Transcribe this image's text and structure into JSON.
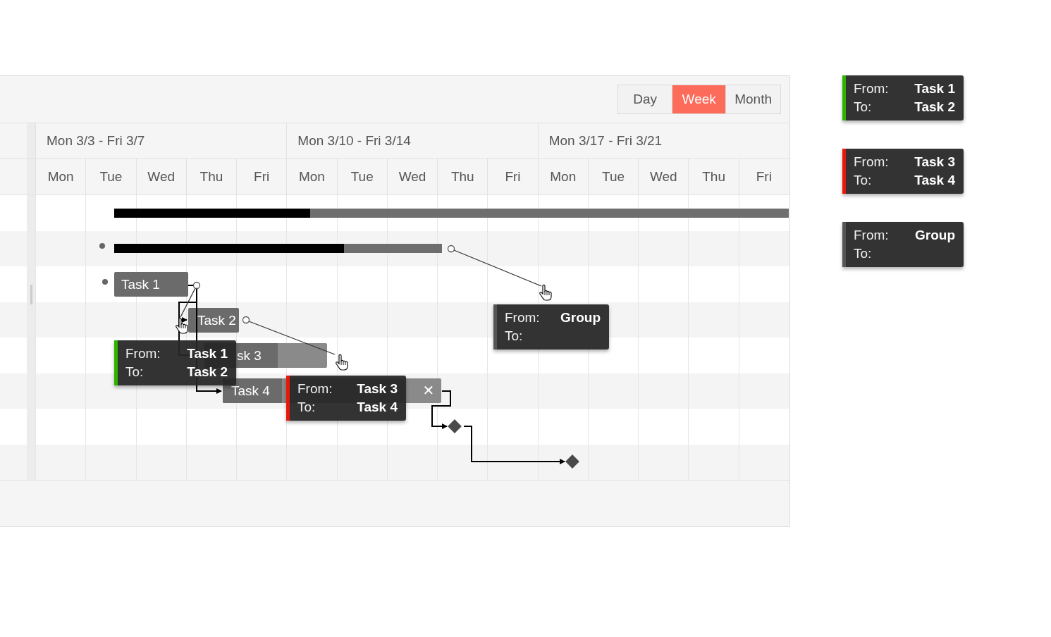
{
  "view_switcher": [
    {
      "label": "Day",
      "selected": false
    },
    {
      "label": "Week",
      "selected": true
    },
    {
      "label": "Month",
      "selected": false
    }
  ],
  "weeks": [
    "Mon 3/3 - Fri 3/7",
    "Mon 3/10 - Fri 3/14",
    "Mon 3/17 - Fri 3/21"
  ],
  "days": [
    "Mon",
    "Tue",
    "Wed",
    "Thu",
    "Fri",
    "Mon",
    "Tue",
    "Wed",
    "Thu",
    "Fri",
    "Mon",
    "Tue",
    "Wed",
    "Thu",
    "Fri"
  ],
  "bars": [
    {
      "kind": "summary",
      "level": 0.29
    },
    {
      "kind": "summary",
      "level": 0.7
    },
    {
      "kind": "task",
      "label": "Task 1"
    },
    {
      "kind": "task",
      "label": "Task 2"
    },
    {
      "kind": "task",
      "label": "sk 3",
      "level": 0.6
    },
    {
      "kind": "task",
      "label": "Task 4",
      "level": 0.27,
      "delete": "✕"
    },
    {
      "kind": "milestone"
    },
    {
      "kind": "milestone"
    }
  ],
  "chart_tooltips": [
    {
      "from_label": "From:",
      "from": "Task 1",
      "to_label": "To:",
      "to": "Task 2",
      "color": "#2db400"
    },
    {
      "from_label": "From:",
      "from": "Task 3",
      "to_label": "To:",
      "to": "Task 4",
      "color": "#e8190c"
    },
    {
      "from_label": "From:",
      "from": "Group",
      "to_label": "To:",
      "color": "#555555"
    }
  ],
  "legend_tooltips": [
    {
      "from_label": "From:",
      "from": "Task 1",
      "to_label": "To:",
      "to": "Task 2",
      "color": "#2db400"
    },
    {
      "from_label": "From:",
      "from": "Task 3",
      "to_label": "To:",
      "to": "Task 4",
      "color": "#e8190c"
    },
    {
      "from_label": "From:",
      "from": "Group",
      "to_label": "To:",
      "color": "#555555"
    }
  ]
}
